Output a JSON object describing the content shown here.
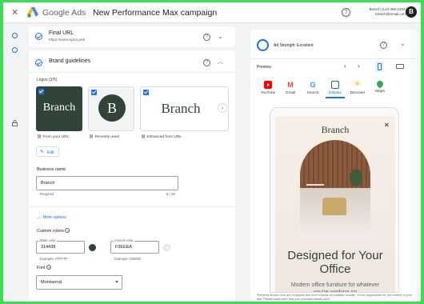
{
  "topbar": {
    "close_icon": "close-icon",
    "product_name": "Google Ads",
    "campaign_title": "New Performance Max campaign",
    "account_line1": "Branch (123-456-1234)",
    "account_line2": "branch@email.com",
    "avatar_letter": "B"
  },
  "final_url": {
    "title": "Final URL",
    "value": "https://www.spsa.pet/"
  },
  "brand_guidelines": {
    "title": "Brand guidelines",
    "logos_label": "Logos (3/5)",
    "logos": [
      {
        "wordmark": "Branch",
        "caption": "From your URL",
        "caption_icon": "link-icon"
      },
      {
        "wordmark": "B",
        "caption": "Recently used",
        "caption_icon": "link-icon"
      },
      {
        "wordmark": "Branch",
        "caption": "Enhanced from URL",
        "caption_icon": "link-icon"
      }
    ],
    "edit_label": "Edit",
    "business_name_label": "Business name",
    "business_name_value": "Branch",
    "required_label": "Required",
    "char_count": "6 / 25",
    "more_options": "More options",
    "custom_colors_label": "Custom colors",
    "main_color_label": "Main color",
    "main_color_value": "314438",
    "main_color_example": "Example: FFFFFF",
    "accent_color_label": "Accent color",
    "accent_color_value": "F3EEEA",
    "accent_color_example": "Example: 000000",
    "font_label": "Font",
    "font_value": "Montserrat"
  },
  "preview_panel": {
    "ad_strength": "Ad Strength: Excellent",
    "preview_label": "Preview",
    "apps": [
      "YouTube",
      "Gmail",
      "Search",
      "Display",
      "Discover",
      "Maps"
    ],
    "selected_app": "Display",
    "ad": {
      "brand": "Branch",
      "headline": "Designed for Your Office",
      "description": "Modern office furniture for whatever you're working on"
    },
    "disclaimer": "Previews shown here are examples and don't include all possible formats. You're responsible for the content of your ads. Please make sure that your provided assets don't"
  },
  "colors": {
    "brand_dark": "#314438",
    "accent": "#F3EEEA",
    "google_blue": "#1a73e8"
  }
}
